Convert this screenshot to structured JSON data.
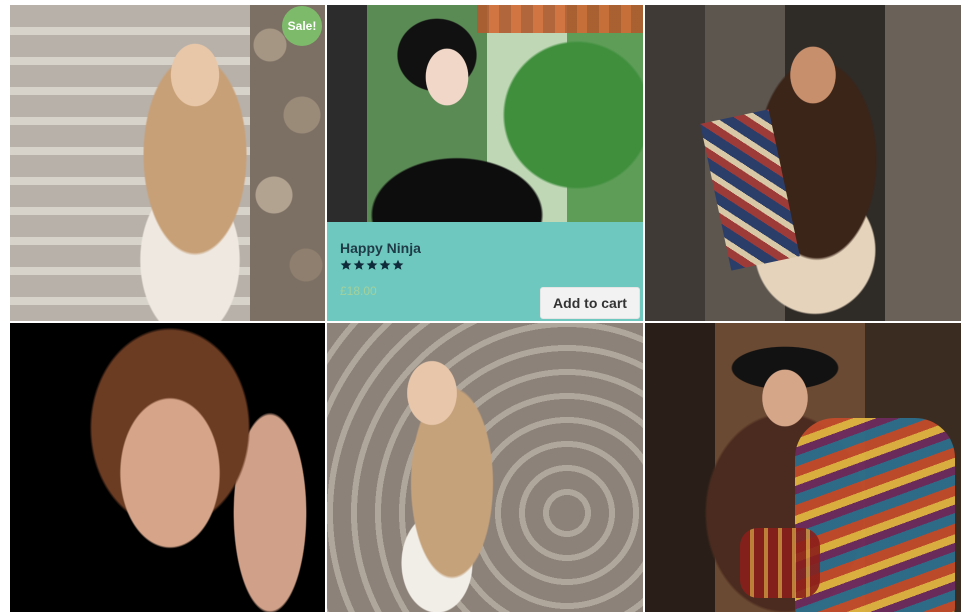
{
  "products": [
    {
      "sale_badge": "Sale!"
    },
    {
      "name": "Happy Ninja",
      "rating": 5,
      "price": "£18.00",
      "add_to_cart": "Add to cart"
    },
    {},
    {},
    {},
    {}
  ],
  "colors": {
    "sale_badge": "#7dbb6b",
    "overlay": "#6ec8bf",
    "title": "#1e3b47",
    "price": "#a3d19b"
  }
}
